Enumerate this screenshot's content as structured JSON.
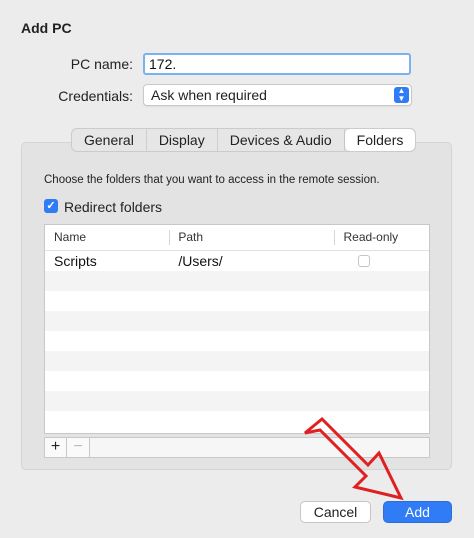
{
  "dialog": {
    "title": "Add PC"
  },
  "form": {
    "pc_name_label": "PC name:",
    "pc_name_value": "172.",
    "credentials_label": "Credentials:",
    "credentials_value": "Ask when required"
  },
  "tabs": [
    {
      "label": "General"
    },
    {
      "label": "Display"
    },
    {
      "label": "Devices & Audio"
    },
    {
      "label": "Folders"
    }
  ],
  "folders": {
    "description": "Choose the folders that you want to access in the remote session.",
    "redirect_label": "Redirect folders",
    "columns": {
      "name": "Name",
      "path": "Path",
      "readonly": "Read-only"
    },
    "rows": [
      {
        "name": "Scripts",
        "path": "/Users/"
      }
    ],
    "add_symbol": "+",
    "remove_symbol": "−"
  },
  "buttons": {
    "cancel": "Cancel",
    "add": "Add"
  },
  "colors": {
    "accent": "#2f7cf6",
    "annotation_arrow": "#e02020"
  },
  "icons": {
    "select_chevron": "chevron-updown-icon",
    "checkbox": "checkmark-icon",
    "annotation": "arrow-pointer-icon"
  }
}
